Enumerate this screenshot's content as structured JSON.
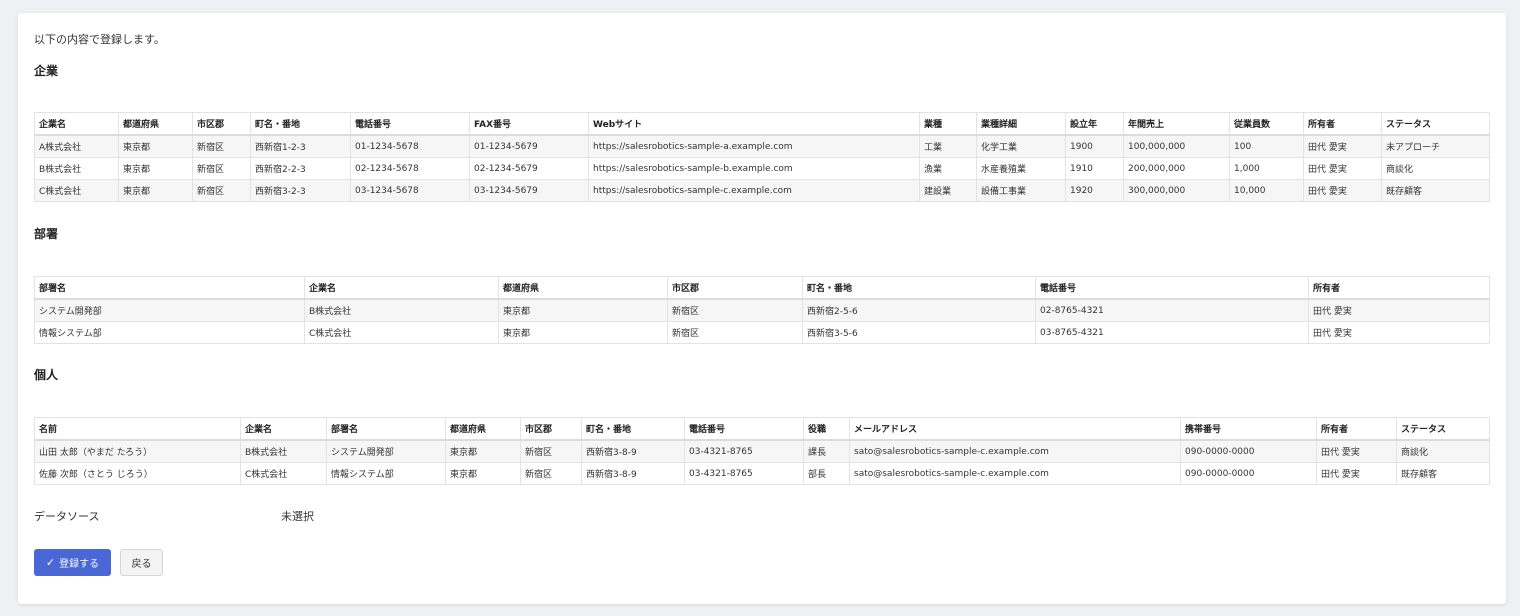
{
  "intro": "以下の内容で登録します。",
  "companies": {
    "title": "企業",
    "headers": [
      "企業名",
      "都道府県",
      "市区郡",
      "町名・番地",
      "電話番号",
      "FAX番号",
      "Webサイト",
      "業種",
      "業種詳細",
      "設立年",
      "年間売上",
      "従業員数",
      "所有者",
      "ステータス"
    ],
    "rows": [
      [
        "A株式会社",
        "東京都",
        "新宿区",
        "西新宿1-2-3",
        "01-1234-5678",
        "01-1234-5679",
        "https://salesrobotics-sample-a.example.com",
        "工業",
        "化学工業",
        "1900",
        "100,000,000",
        "100",
        "田代 愛実",
        "未アプローチ"
      ],
      [
        "B株式会社",
        "東京都",
        "新宿区",
        "西新宿2-2-3",
        "02-1234-5678",
        "02-1234-5679",
        "https://salesrobotics-sample-b.example.com",
        "漁業",
        "水産養殖業",
        "1910",
        "200,000,000",
        "1,000",
        "田代 愛実",
        "商談化"
      ],
      [
        "C株式会社",
        "東京都",
        "新宿区",
        "西新宿3-2-3",
        "03-1234-5678",
        "03-1234-5679",
        "https://salesrobotics-sample-c.example.com",
        "建設業",
        "設備工事業",
        "1920",
        "300,000,000",
        "10,000",
        "田代 愛実",
        "既存顧客"
      ]
    ]
  },
  "departments": {
    "title": "部署",
    "headers": [
      "部署名",
      "企業名",
      "都道府県",
      "市区郡",
      "町名・番地",
      "電話番号",
      "所有者"
    ],
    "rows": [
      [
        "システム開発部",
        "B株式会社",
        "東京都",
        "新宿区",
        "西新宿2-5-6",
        "02-8765-4321",
        "田代 愛実"
      ],
      [
        "情報システム部",
        "C株式会社",
        "東京都",
        "新宿区",
        "西新宿3-5-6",
        "03-8765-4321",
        "田代 愛実"
      ]
    ]
  },
  "individuals": {
    "title": "個人",
    "headers": [
      "名前",
      "企業名",
      "部署名",
      "都道府県",
      "市区郡",
      "町名・番地",
      "電話番号",
      "役職",
      "メールアドレス",
      "携帯番号",
      "所有者",
      "ステータス"
    ],
    "rows": [
      [
        "山田 太郎（やまだ たろう）",
        "B株式会社",
        "システム開発部",
        "東京都",
        "新宿区",
        "西新宿3-8-9",
        "03-4321-8765",
        "課長",
        "sato@salesrobotics-sample-c.example.com",
        "090-0000-0000",
        "田代 愛実",
        "商談化"
      ],
      [
        "佐藤 次郎（さとう じろう）",
        "C株式会社",
        "情報システム部",
        "東京都",
        "新宿区",
        "西新宿3-8-9",
        "03-4321-8765",
        "部長",
        "sato@salesrobotics-sample-c.example.com",
        "090-0000-0000",
        "田代 愛実",
        "既存顧客"
      ]
    ]
  },
  "data_source": {
    "label": "データソース",
    "value": "未選択"
  },
  "actions": {
    "register_label": "登録する",
    "register_icon": "check-icon",
    "back_label": "戻る"
  },
  "colors": {
    "primary": "#4a67d6"
  }
}
